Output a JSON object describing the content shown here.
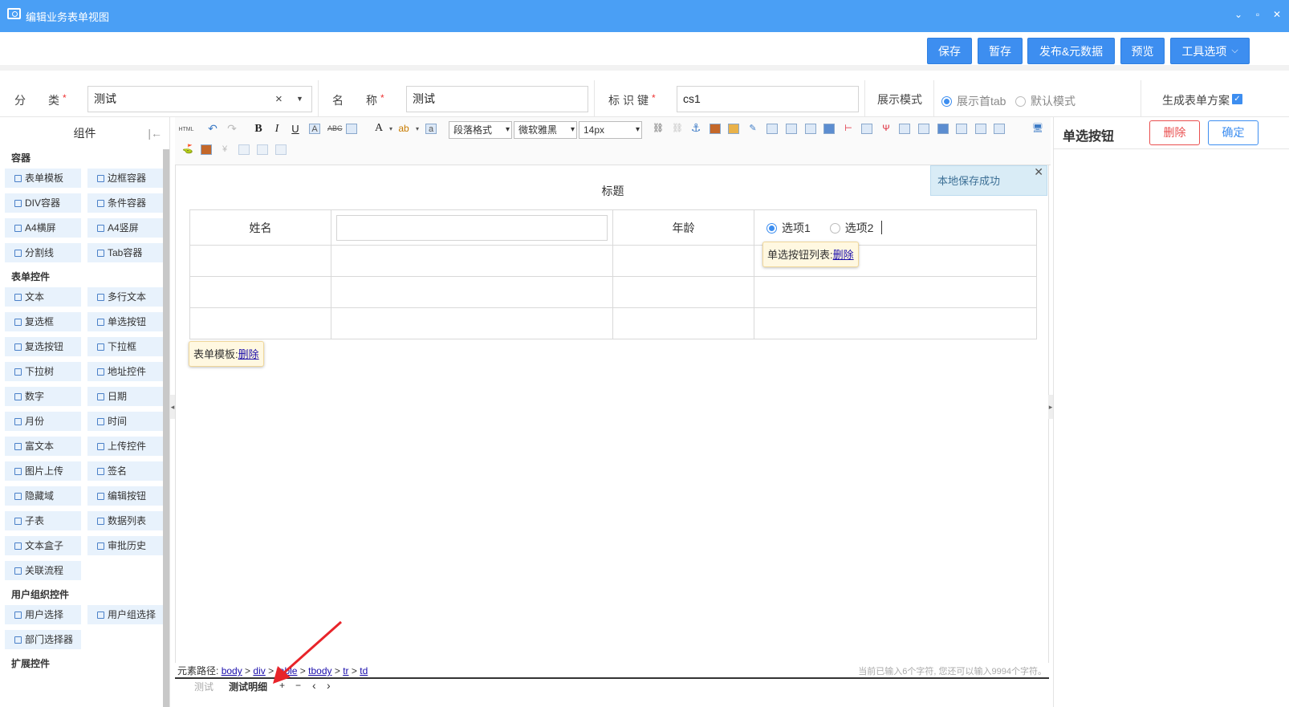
{
  "window": {
    "title": "编辑业务表单视图",
    "controls": [
      "⌄",
      "▫",
      "✕"
    ]
  },
  "toolbar": {
    "save": "保存",
    "temp_save": "暂存",
    "publish": "发布&元数据",
    "preview": "预览",
    "tools": "工具选项"
  },
  "form": {
    "category_label": "分　　类",
    "category_value": "测试",
    "category_clear": "×",
    "name_label": "名　　称",
    "name_value": "测试",
    "key_label": "标识键",
    "key_value": "cs1",
    "display_label": "展示模式",
    "opt_first_tab": "展示首tab",
    "opt_default": "默认模式",
    "gen_label": "生成表单方案",
    "required": "*"
  },
  "left": {
    "title": "组件",
    "collapse": "|←",
    "sections": [
      {
        "title": "容器",
        "items": [
          "表单模板",
          "边框容器",
          "DIV容器",
          "条件容器",
          "A4横屏",
          "A4竖屏",
          "分割线",
          "Tab容器"
        ]
      },
      {
        "title": "表单控件",
        "items": [
          "文本",
          "多行文本",
          "复选框",
          "单选按钮",
          "复选按钮",
          "下拉框",
          "下拉树",
          "地址控件",
          "数字",
          "日期",
          "月份",
          "时间",
          "富文本",
          "上传控件",
          "图片上传",
          "签名",
          "隐藏域",
          "编辑按钮",
          "子表",
          "数据列表",
          "文本盒子",
          "审批历史",
          "关联流程"
        ]
      },
      {
        "title": "用户组织控件",
        "items": [
          "用户选择",
          "用户组选择",
          "部门选择器"
        ]
      },
      {
        "title": "扩展控件",
        "items": []
      }
    ]
  },
  "editor": {
    "html_label": "HTML",
    "paragraph": "段落格式",
    "font": "微软雅黑",
    "size": "14px",
    "form_title": "标题",
    "row1": {
      "name": "姓名",
      "age": "年龄",
      "opt1": "选项1",
      "opt2": "选项2"
    },
    "tip_radio_label": "单选按钮列表:",
    "tip_radio_link": "删除",
    "tip_form_label": "表单模板:",
    "tip_form_link": "删除",
    "toast": "本地保存成功",
    "toast_close": "✕",
    "path_label": "元素路径:",
    "path": [
      "body",
      "div",
      "table",
      "tbody",
      "tr",
      "td"
    ],
    "char_count": "当前已输入6个字符, 您还可以输入9994个字符。",
    "tab1": "测试",
    "tab2": "测试明细",
    "tab_add": "+",
    "tab_remove": "−",
    "tab_prev": "‹",
    "tab_next": "›"
  },
  "right": {
    "title": "单选按钮",
    "delete": "删除",
    "confirm": "确定"
  },
  "colors": {
    "accent": "#3d8ef0",
    "titlebar": "#4a9ff5",
    "danger": "#e94f4f",
    "arrow": "#e8242a"
  }
}
